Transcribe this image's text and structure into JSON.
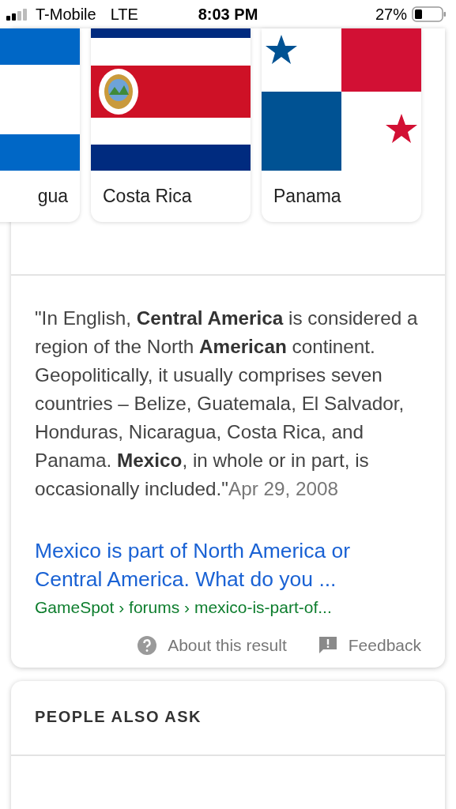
{
  "status_bar": {
    "carrier": "T-Mobile",
    "network": "LTE",
    "time": "8:03 PM",
    "battery": "27%"
  },
  "countries": [
    {
      "name": "gua",
      "kind": "nicaragua"
    },
    {
      "name": "Costa Rica",
      "kind": "costa_rica"
    },
    {
      "name": "Panama",
      "kind": "panama"
    }
  ],
  "snippet": {
    "text": "\"In English, **Central America** is considered a region of the North **American** continent. Geopolitically, it usually comprises seven countries – Belize, Guatemala, El Salvador, Honduras, Nicaragua, Costa Rica, and Panama. **Mexico**, in whole or in part, is occasionally included.\"",
    "date": "Apr 29, 2008"
  },
  "result": {
    "title": "Mexico is part of North America or Central America. What do you ...",
    "breadcrumb": "GameSpot › forums › mexico-is-part-of..."
  },
  "footer": [
    {
      "kind": "about",
      "label": "About this result"
    },
    {
      "kind": "feedback",
      "label": "Feedback"
    }
  ],
  "people_also_ask": {
    "heading": "PEOPLE ALSO ASK"
  }
}
